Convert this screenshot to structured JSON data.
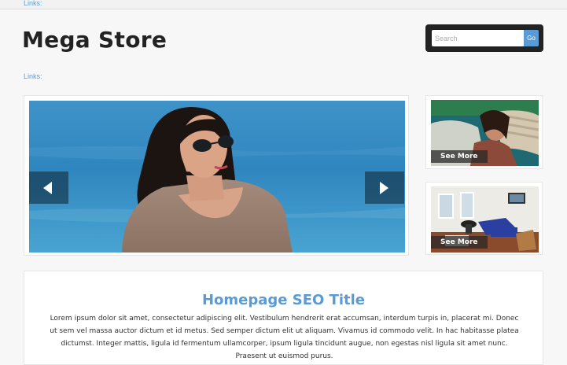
{
  "header": {
    "top_links_label": "Links:",
    "logo_text": "Mega Store",
    "search_placeholder": "Search",
    "search_button_label": "Go",
    "links_label": "Links:"
  },
  "slider": {
    "prev_icon": "chevron-left-icon",
    "next_icon": "chevron-right-icon"
  },
  "promos": [
    {
      "label": "See More",
      "image": "woman-in-car"
    },
    {
      "label": "See More",
      "image": "living-room"
    }
  ],
  "seo": {
    "title": "Homepage SEO Title",
    "body": "Lorem ipsum dolor sit amet, consectetur adipiscing elit. Vestibulum hendrerit erat accumsan, interdum turpis in, placerat mi. Donec ut sem vel massa auctor dictum et id metus. Sed semper dictum elit ut aliquam. Vivamus id commodo velit. In hac habitasse platea dictumst. Integer mattis, ligula id fermentum ullamcorper, ipsum ligula tincidunt augue, non egestas nisl ligula sit amet nunc. Praesent ut euismod purus."
  },
  "colors": {
    "accent": "#5b9bd5",
    "search_bg": "#222222",
    "page_bg": "#f7f7f7"
  }
}
